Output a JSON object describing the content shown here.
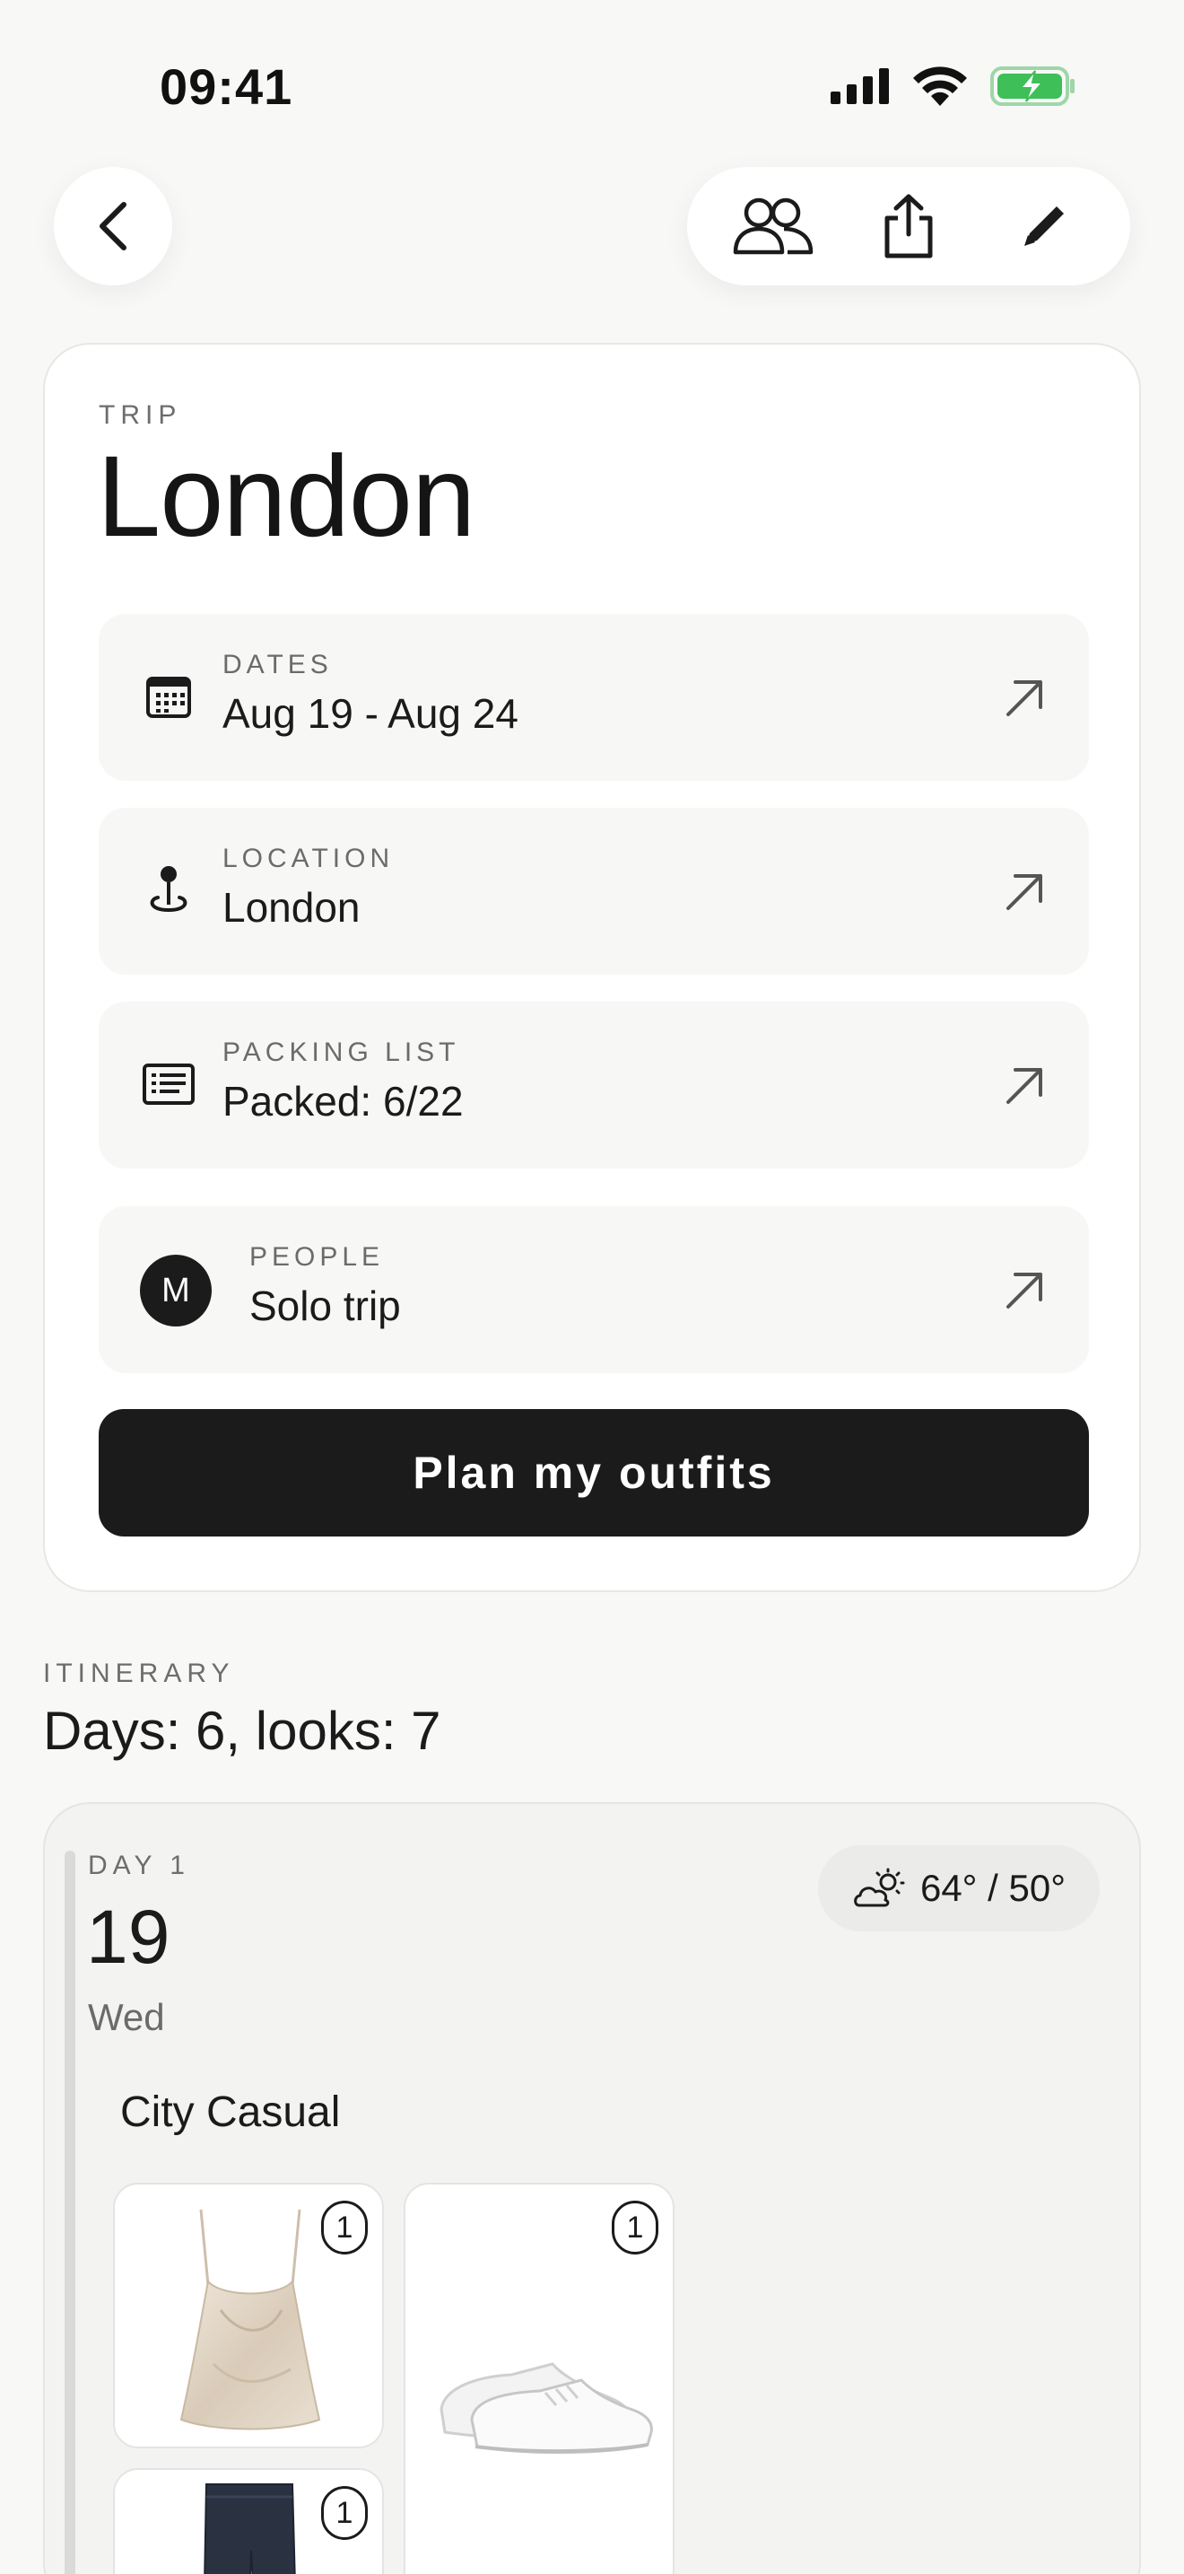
{
  "status_bar": {
    "time": "09:41"
  },
  "trip": {
    "eyebrow": "TRIP",
    "title": "London",
    "rows": [
      {
        "label": "DATES",
        "value": "Aug 19 - Aug 24",
        "icon": "calendar-icon"
      },
      {
        "label": "LOCATION",
        "value": "London",
        "icon": "map-pin-icon"
      },
      {
        "label": "PACKING LIST",
        "value": "Packed: 6/22",
        "icon": "list-icon"
      },
      {
        "label": "PEOPLE",
        "value": "Solo trip",
        "avatar_initial": "M"
      }
    ],
    "plan_button": "Plan my outfits"
  },
  "itinerary": {
    "eyebrow": "ITINERARY",
    "summary": "Days: 6, looks: 7",
    "days": [
      {
        "label": "DAY 1",
        "date": "19",
        "weekday": "Wed",
        "weather": "64° / 50°",
        "look": "City Casual",
        "items": [
          {
            "name": "champagne silk camisole",
            "qty": "1"
          },
          {
            "name": "white sneakers",
            "qty": "1"
          },
          {
            "name": "dark jeans",
            "qty": "1"
          }
        ]
      }
    ]
  },
  "colors": {
    "accent": "#1b1b1b",
    "background": "#f8f8f7",
    "battery": "#3fbf57"
  }
}
